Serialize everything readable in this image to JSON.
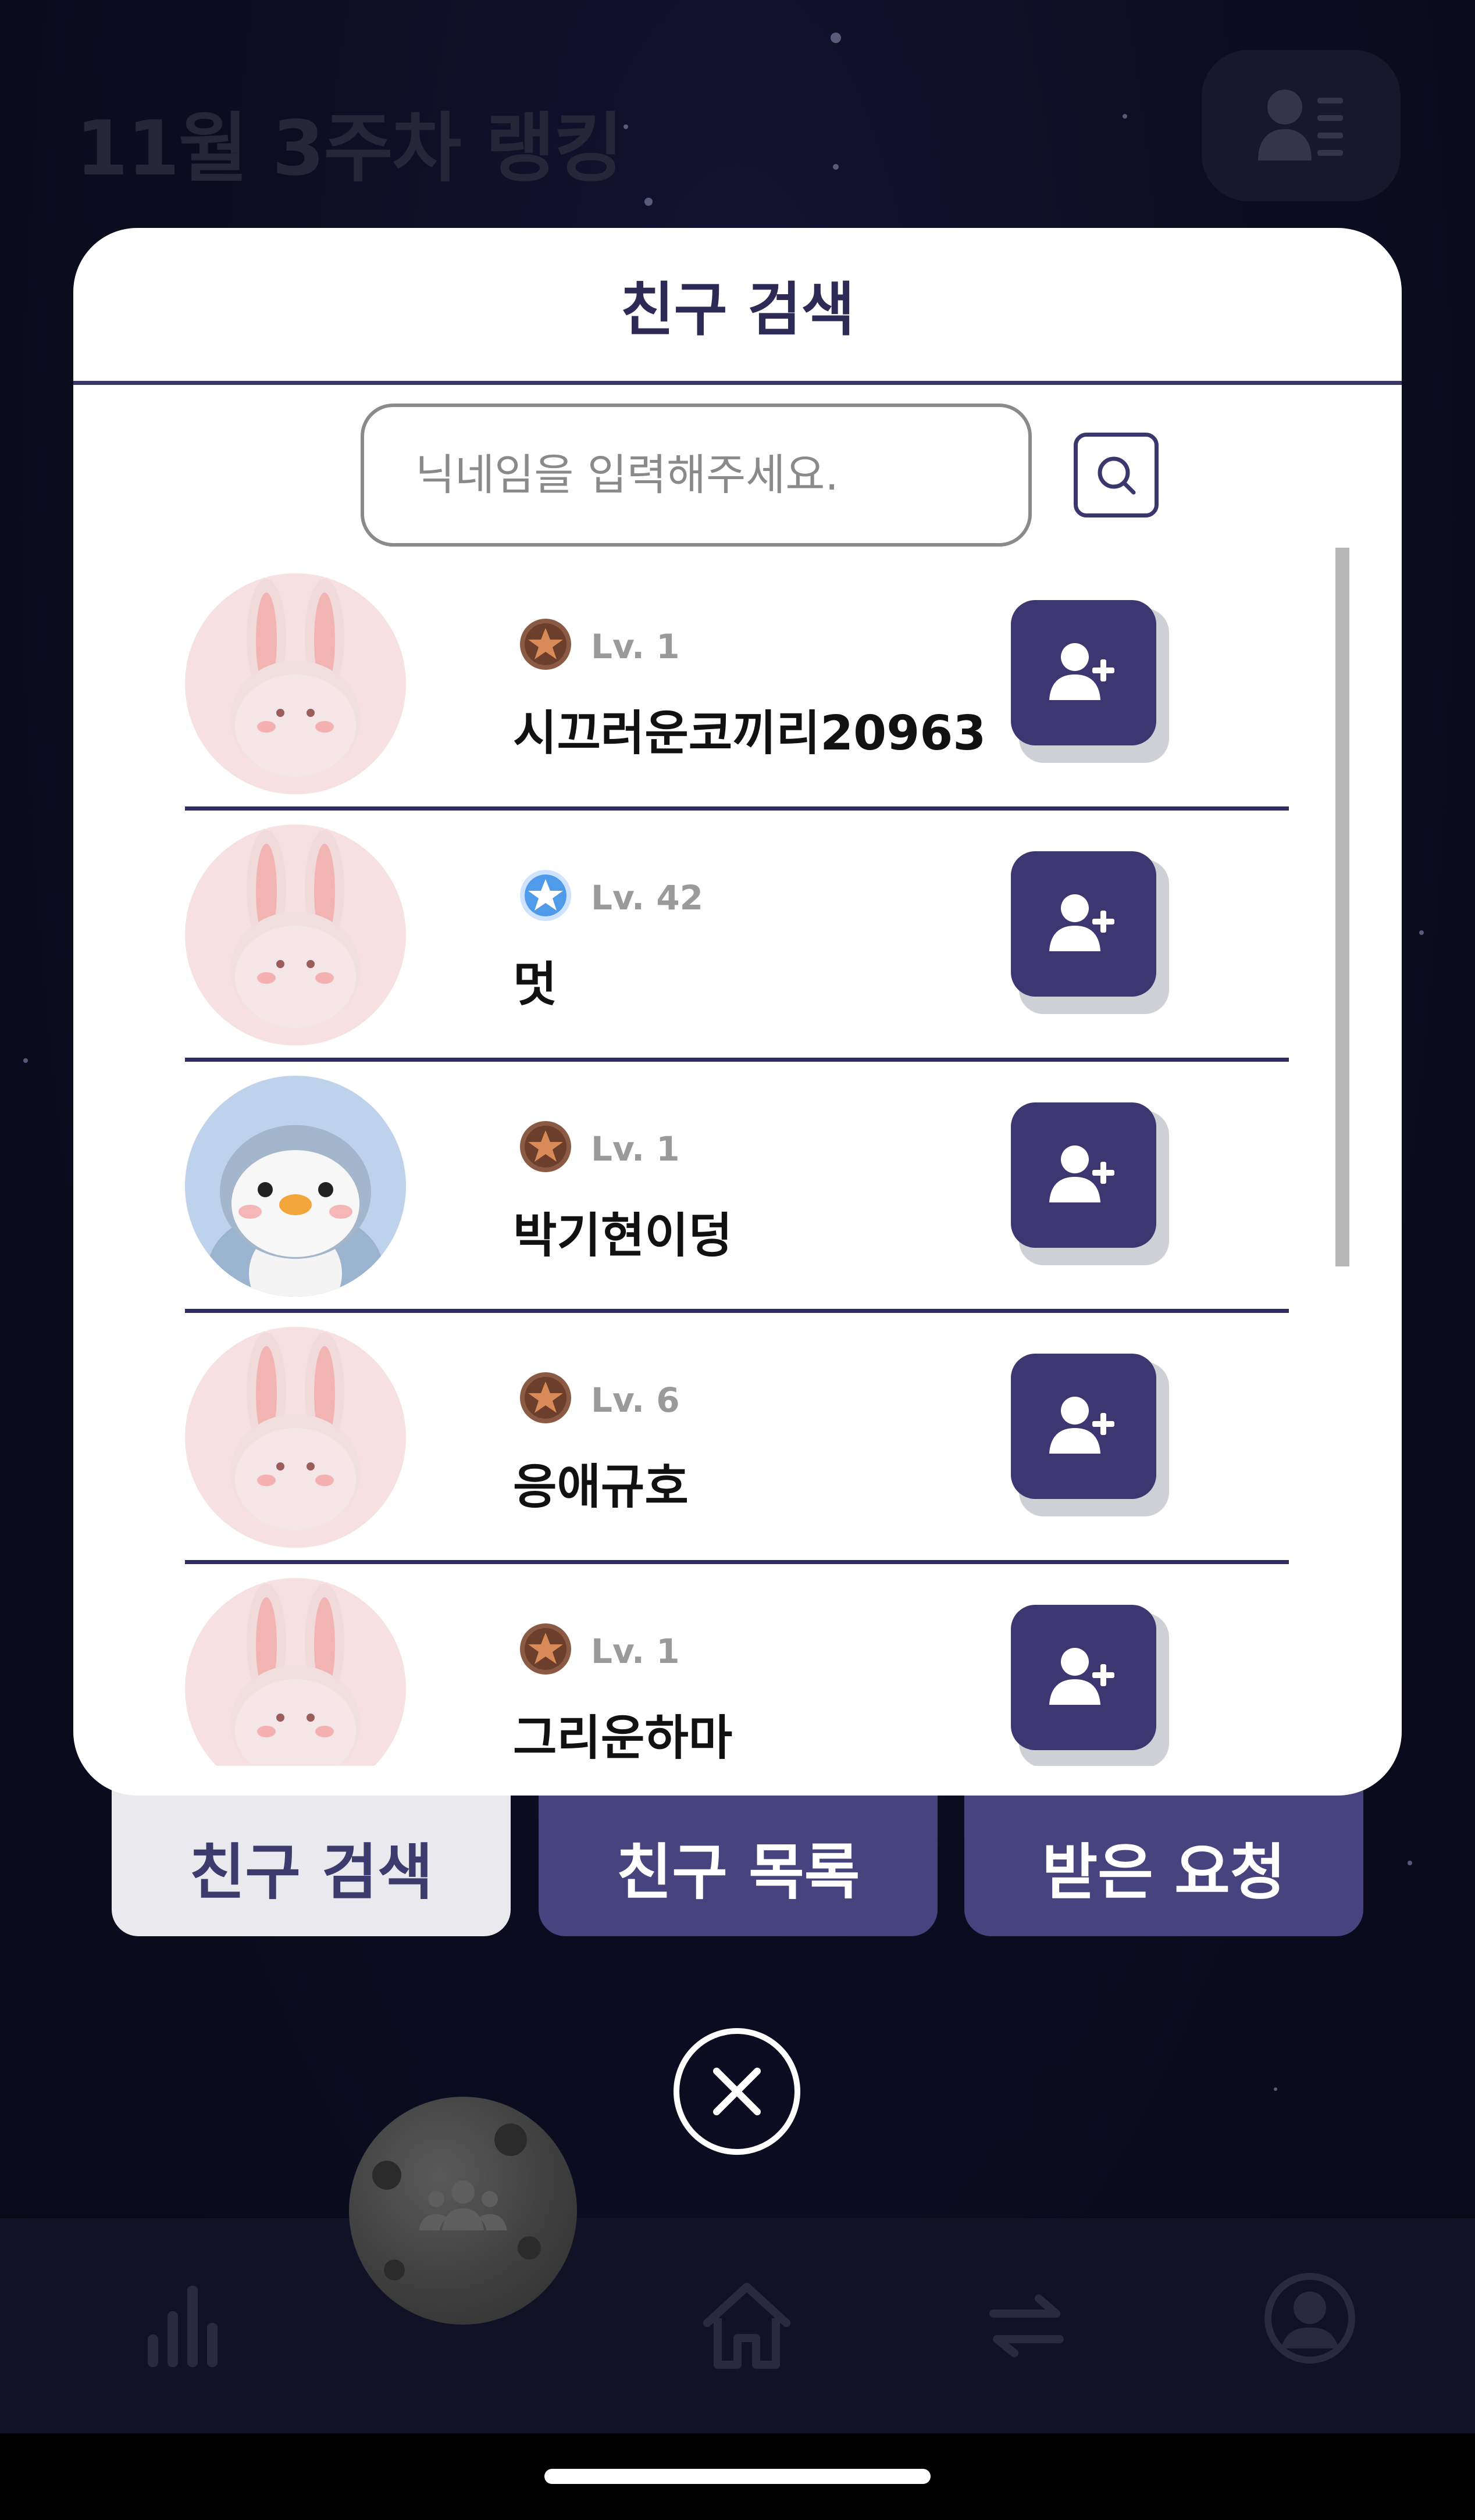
{
  "background": {
    "title": "11월 3주차 랭킹"
  },
  "modal": {
    "title": "친구 검색",
    "search": {
      "placeholder": "닉네임을 입력해주세요.",
      "value": ""
    },
    "results": [
      {
        "avatar": "rabbit",
        "badge": "bronze-star",
        "level": "Lv. 1",
        "nickname": "시끄러운코끼리20963"
      },
      {
        "avatar": "rabbit",
        "badge": "blue-star",
        "level": "Lv. 42",
        "nickname": "멋"
      },
      {
        "avatar": "penguin",
        "badge": "bronze-star",
        "level": "Lv. 1",
        "nickname": "박기현이덩"
      },
      {
        "avatar": "rabbit",
        "badge": "bronze-star",
        "level": "Lv. 6",
        "nickname": "응애규호"
      },
      {
        "avatar": "rabbit",
        "badge": "bronze-star",
        "level": "Lv. 1",
        "nickname": "그리운하마"
      }
    ]
  },
  "tabs": [
    {
      "label": "친구 검색",
      "active": true
    },
    {
      "label": "친구 목록",
      "active": false
    },
    {
      "label": "받은 요청",
      "active": false
    }
  ],
  "colors": {
    "accent": "#3c3770",
    "tab_active_bg": "#e9e9ee",
    "tab_inactive_bg": "#47437e",
    "background": "#0b0b1c"
  },
  "icons": [
    "profile-list-icon",
    "search-icon",
    "add-friend-icon",
    "close-icon",
    "ranking-chart-icon",
    "home-icon",
    "exchange-icon",
    "user-circle-icon",
    "group-icon"
  ]
}
